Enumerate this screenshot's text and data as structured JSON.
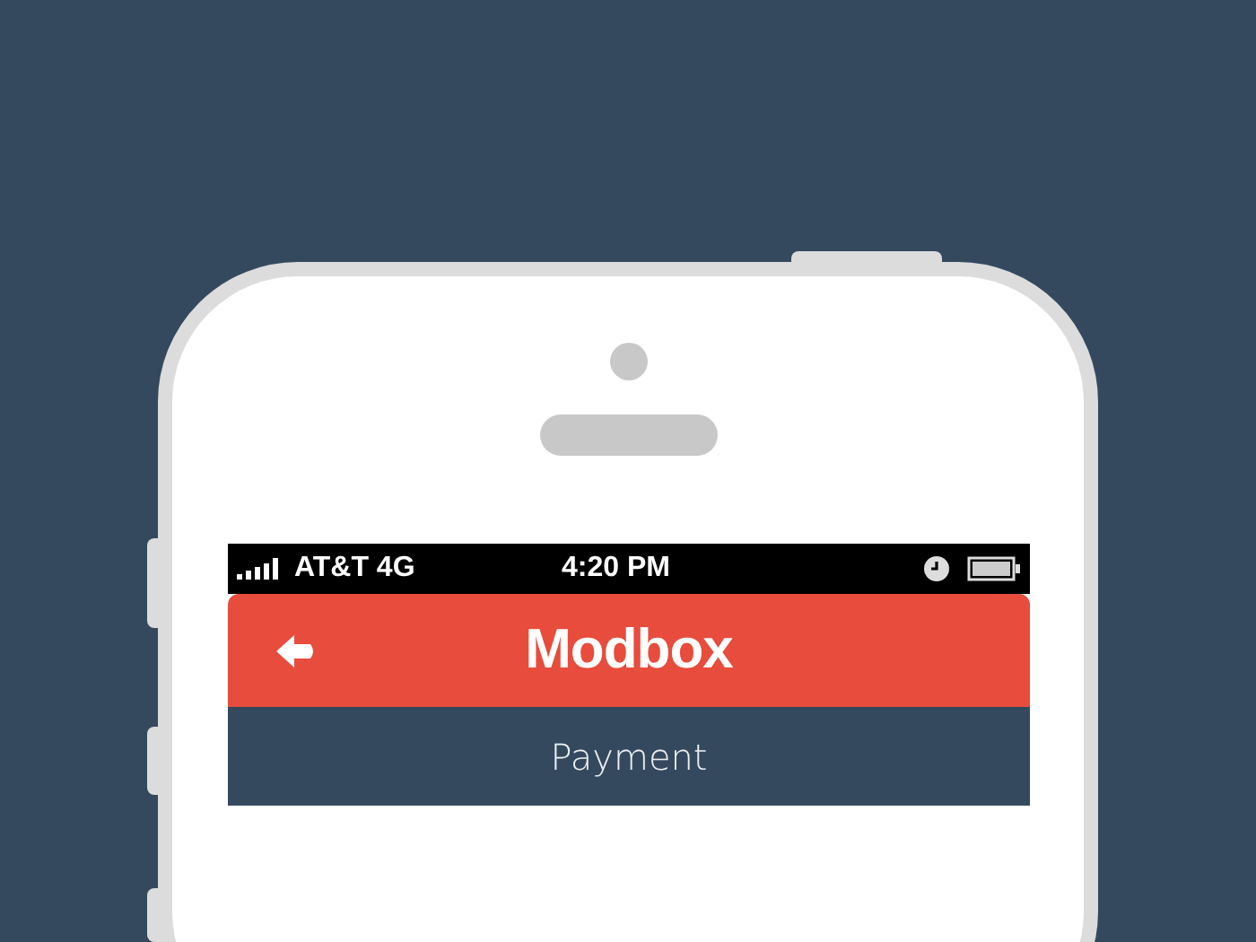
{
  "status_bar": {
    "carrier": "AT&T 4G",
    "time": "4:20 PM"
  },
  "header": {
    "title": "Modbox"
  },
  "subheader": {
    "title": "Payment"
  }
}
